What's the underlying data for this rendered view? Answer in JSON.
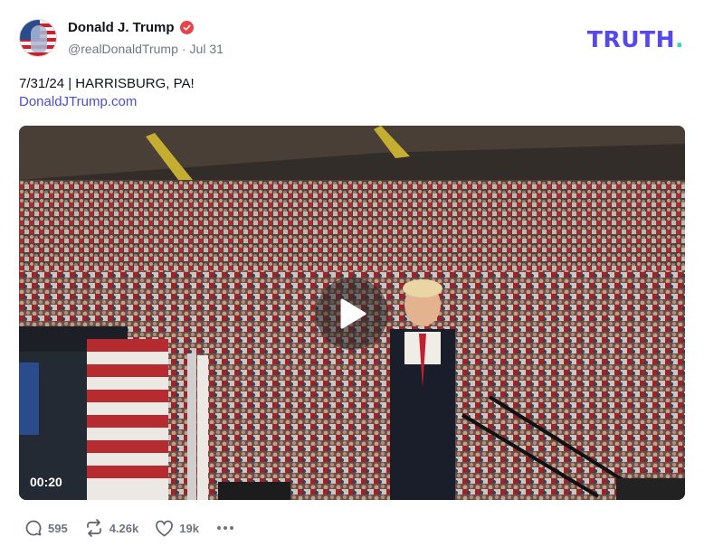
{
  "author": {
    "display_name": "Donald J. Trump",
    "handle": "@realDonaldTrump",
    "separator": "·",
    "date": "Jul 31",
    "verified_color": "#e8434b"
  },
  "brand": {
    "logo_main": "TRUTH",
    "logo_dot": ".",
    "logo_color": "#5448ee",
    "dot_color": "#2fd8b3"
  },
  "post": {
    "text": "7/31/24 | HARRISBURG, PA!",
    "link": "DonaldJTrump.com"
  },
  "media": {
    "type": "video",
    "duration": "00:20",
    "play_icon": "play-icon"
  },
  "actions": {
    "reply_count": "595",
    "retruth_count": "4.26k",
    "like_count": "19k"
  },
  "icons": [
    "reply-icon",
    "retruth-icon",
    "heart-icon",
    "more-icon",
    "verified-badge-icon"
  ]
}
